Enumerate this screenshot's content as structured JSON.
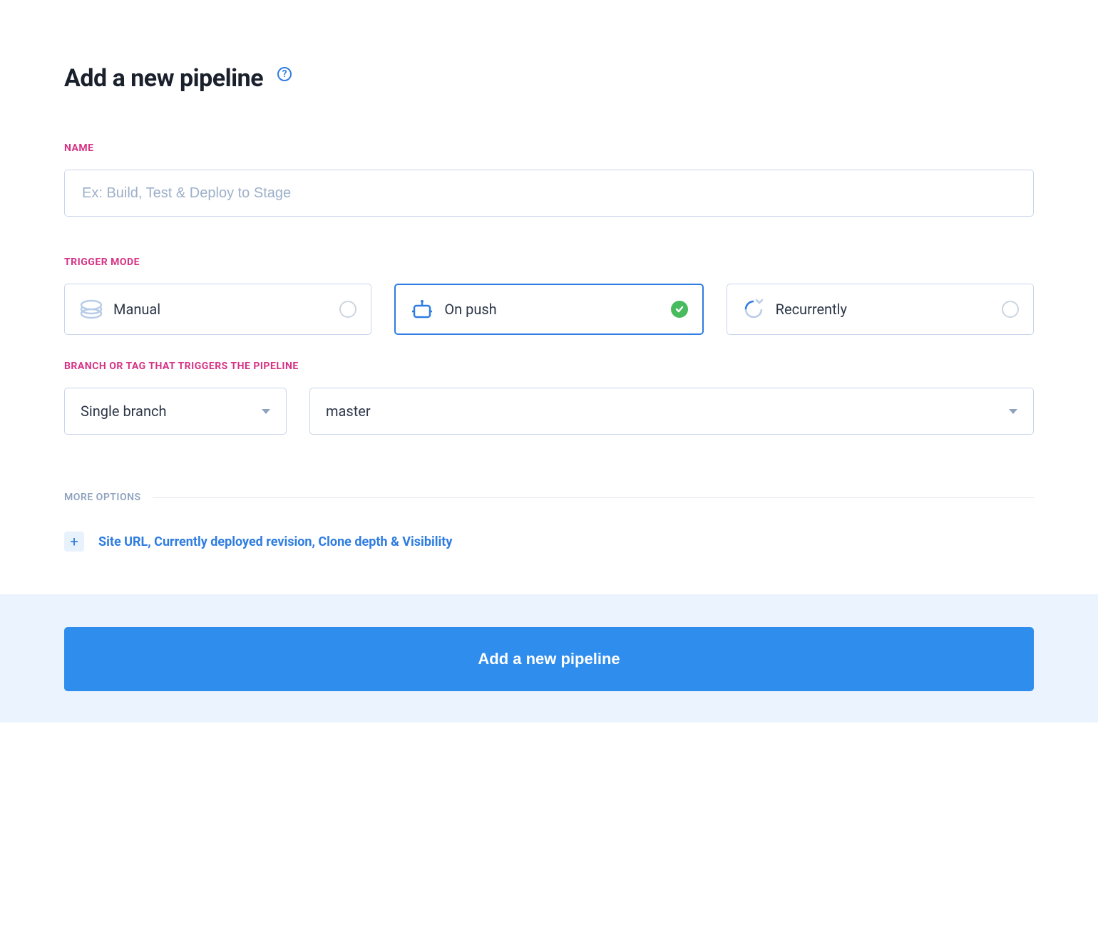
{
  "header": {
    "title": "Add a new pipeline"
  },
  "name": {
    "label": "NAME",
    "placeholder": "Ex: Build, Test & Deploy to Stage",
    "value": ""
  },
  "trigger": {
    "label": "TRIGGER MODE",
    "options": [
      {
        "id": "manual",
        "label": "Manual",
        "icon": "manual-icon",
        "selected": false
      },
      {
        "id": "on_push",
        "label": "On push",
        "icon": "robot-icon",
        "selected": true
      },
      {
        "id": "recurrently",
        "label": "Recurrently",
        "icon": "recurring-icon",
        "selected": false
      }
    ]
  },
  "branch": {
    "label": "BRANCH OR TAG THAT TRIGGERS THE PIPELINE",
    "scope": "Single branch",
    "value": "master"
  },
  "more_options": {
    "label": "MORE OPTIONS",
    "expand_text": "Site URL, Currently deployed revision, Clone depth & Visibility"
  },
  "submit": {
    "label": "Add a new pipeline"
  }
}
